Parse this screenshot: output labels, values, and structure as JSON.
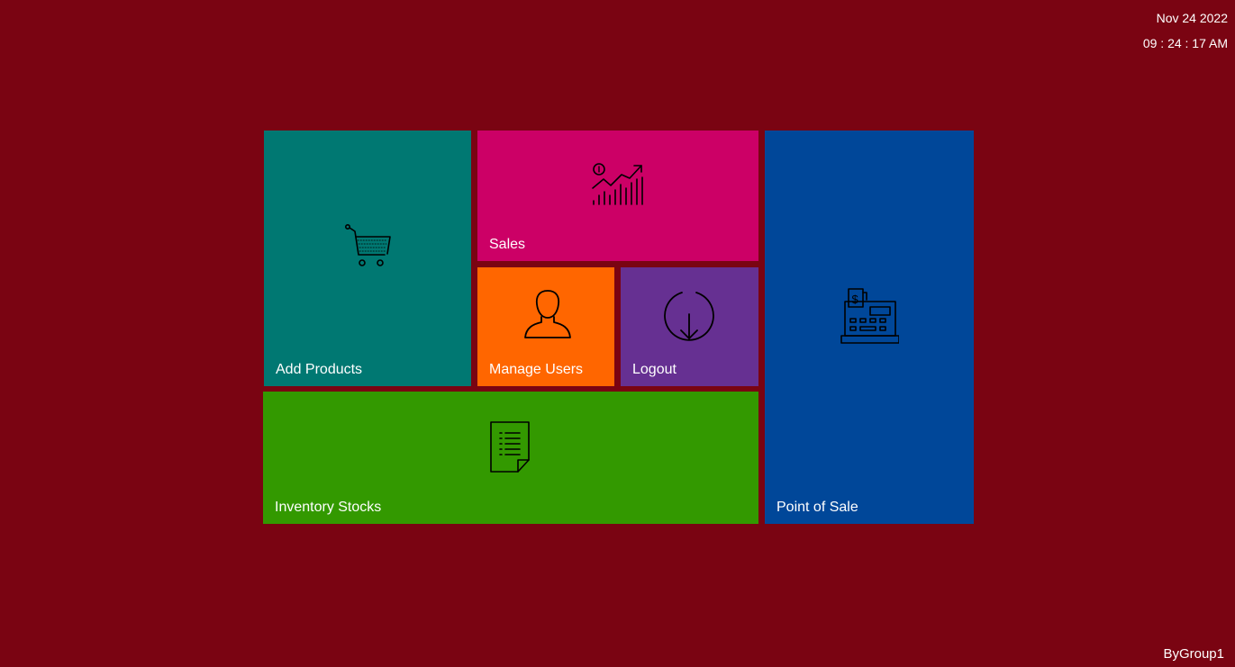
{
  "clock": {
    "date": "Nov  24  2022",
    "time": "09 : 24 : 17 AM"
  },
  "tiles": [
    {
      "label": "Add Products",
      "color": "#007872",
      "icon": "shopping-cart-icon"
    },
    {
      "label": "Sales",
      "color": "#cc0066",
      "icon": "sales-growth-chart-icon"
    },
    {
      "label": "Point of Sale",
      "color": "#004799",
      "icon": "cash-register-icon"
    },
    {
      "label": "Manage Users",
      "color": "#ff6600",
      "icon": "user-icon"
    },
    {
      "label": "Logout",
      "color": "#663092",
      "icon": "download-circle-icon"
    },
    {
      "label": "Inventory Stocks",
      "color": "#339900",
      "icon": "document-list-icon"
    }
  ],
  "footer": {
    "credit": "ByGroup1"
  },
  "background_color": "#7a0412"
}
